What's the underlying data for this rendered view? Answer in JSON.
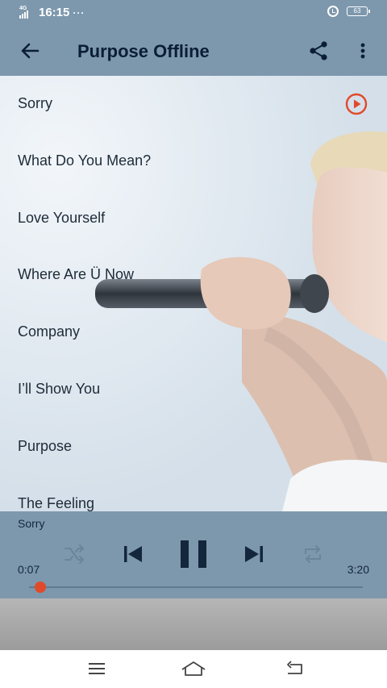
{
  "status_bar": {
    "network": "4G",
    "time": "16:15",
    "dots": "···",
    "battery": "63"
  },
  "app_bar": {
    "title": "Purpose Offline"
  },
  "songs": [
    {
      "title": "Sorry"
    },
    {
      "title": "What Do You Mean?"
    },
    {
      "title": "Love Yourself"
    },
    {
      "title": "Where Are Ü Now"
    },
    {
      "title": "Company"
    },
    {
      "title": "I’ll Show You"
    },
    {
      "title": "Purpose"
    },
    {
      "title": "The Feeling"
    }
  ],
  "player": {
    "now_playing": "Sorry",
    "current_time": "0:07",
    "duration": "3:20",
    "progress": 0.035
  },
  "icons": {
    "back": "arrow-left-icon",
    "share": "share-icon",
    "more": "more-vert-icon",
    "shuffle": "shuffle-icon",
    "previous": "skip-previous-icon",
    "pause": "pause-icon",
    "next": "skip-next-icon",
    "repeat": "repeat-icon",
    "play": "play-circle-icon"
  },
  "colors": {
    "app_bar": "#7d98ad",
    "accent": "#e04a2a",
    "title_text": "#0b1e36"
  }
}
